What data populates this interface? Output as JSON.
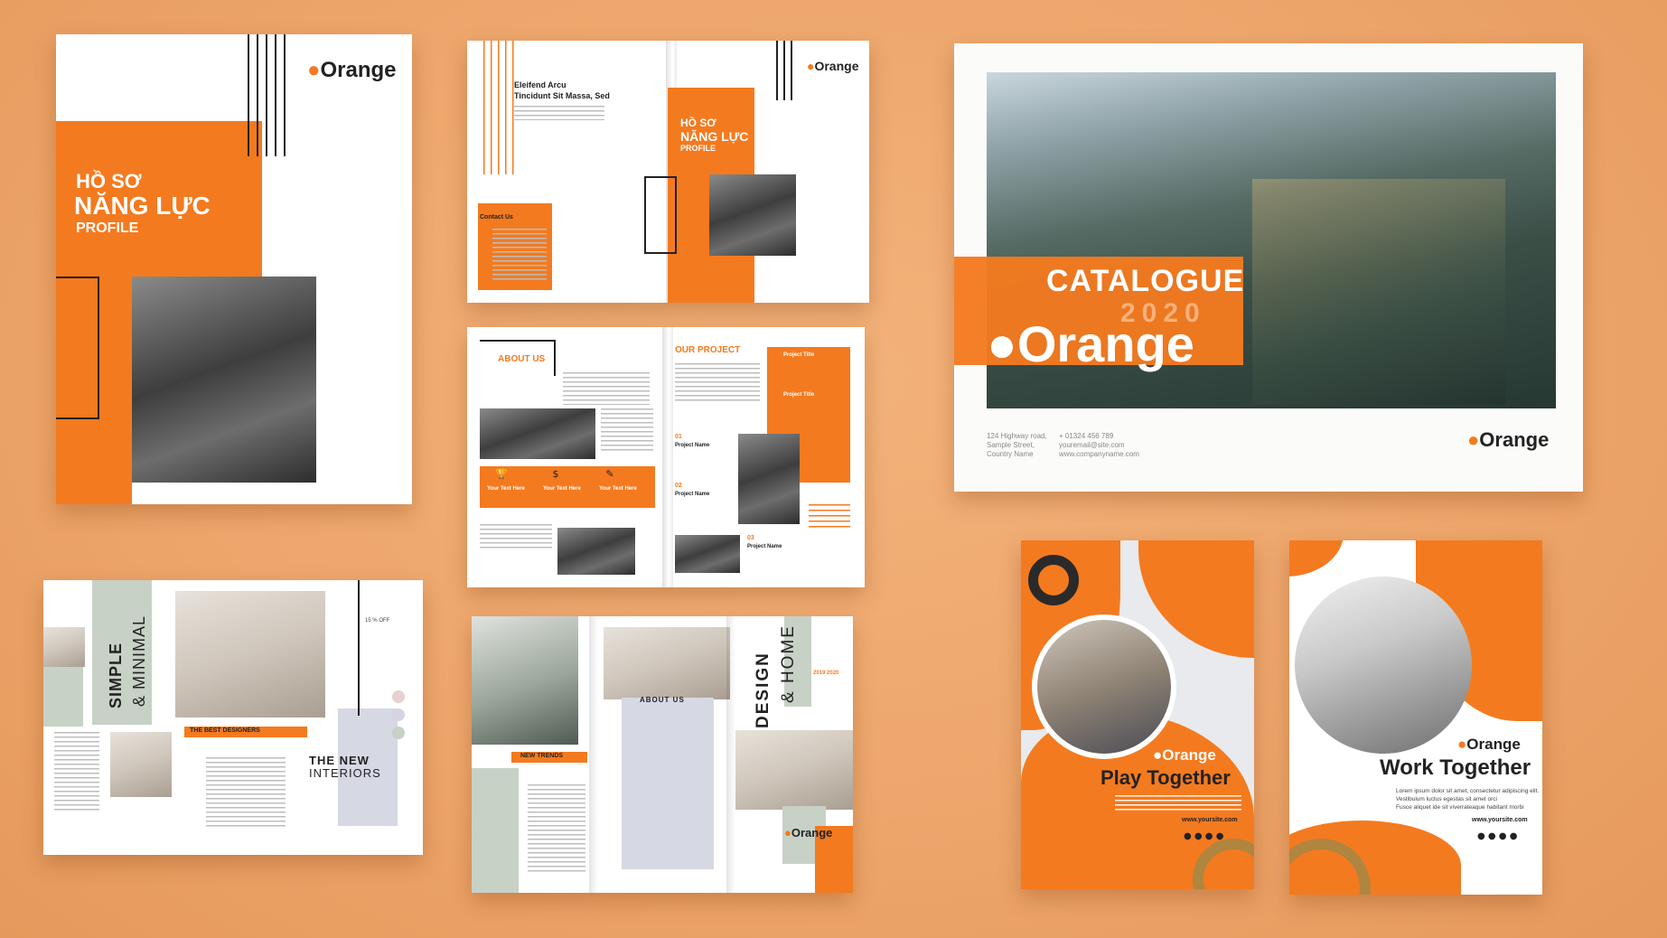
{
  "brand": {
    "logo_text": "Orange",
    "accent": "#f47a1f"
  },
  "profile_cover": {
    "line1": "HỒ SƠ",
    "line2": "NĂNG LỰC",
    "line3": "PROFILE",
    "logo": "Orange"
  },
  "profile_spread": {
    "heading1": "Eleifend Arcu",
    "heading2": "Tincidunt Sit Massa, Sed",
    "contact_title": "Contact Us",
    "title1": "HỒ SƠ",
    "title2": "NĂNG LỰC",
    "title3": "PROFILE",
    "logo": "Orange"
  },
  "about_spread": {
    "about_title": "ABOUT US",
    "project_title": "OUR PROJECT",
    "your_text_here": "Your Text Here",
    "project_title_label": "Project Title",
    "project_name_label": "Project Name",
    "n01": "01",
    "n02": "02",
    "n03": "03"
  },
  "catalogue": {
    "title": "CATALOGUE",
    "year": "2020",
    "logo": "Orange",
    "address": [
      "124 Highway road,",
      "Sample Street,",
      "Country Name"
    ],
    "contact": [
      "+ 01324 456 789",
      "youremail@site.com",
      "www.companyname.com"
    ],
    "footer_logo": "Orange"
  },
  "interior": {
    "simple": "SIMPLE",
    "minimal": "& MINIMAL",
    "best_designers": "THE BEST DESIGNERS",
    "new_interiors_1": "THE NEW",
    "new_interiors_2": "INTERIORS",
    "discount": "15 % OFF"
  },
  "design_home": {
    "design": "DESIGN",
    "home": "& HOME",
    "about": "ABOUT US",
    "trends": "NEW TRENDS",
    "logo": "Orange",
    "year": "2019 2020"
  },
  "play": {
    "logo": "Orange",
    "title": "Play Together",
    "site": "www.yoursite.com"
  },
  "work": {
    "logo": "Orange",
    "title": "Work Together",
    "body": [
      "Lorem ipsum dolor sit amet, consectetur adipiscing elit.",
      "Vestibulum luctus egestas sit amet orci",
      "Fusce aliquet ide sit viverrateaque habitant morbi"
    ],
    "site": "www.yoursite.com"
  }
}
